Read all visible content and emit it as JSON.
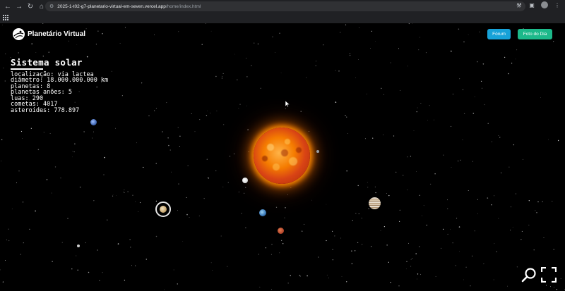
{
  "browser": {
    "url_main": "2025-1-t02-g7-planetario-virtual-em-seven.vercel.app",
    "url_path": "/home/index.html"
  },
  "header": {
    "brand": "Planetário Virtual",
    "forum_label": "Fórum",
    "photo_label": "Foto do Dia"
  },
  "info": {
    "title": "Sistema solar",
    "lines": [
      "localização: via lactea",
      "diâmetro: 18.000.000.000 km",
      "planetas: 8",
      "planetas anões: 5",
      "luas: 290",
      "cometas: 4017",
      "asteroides: 778.897"
    ]
  }
}
